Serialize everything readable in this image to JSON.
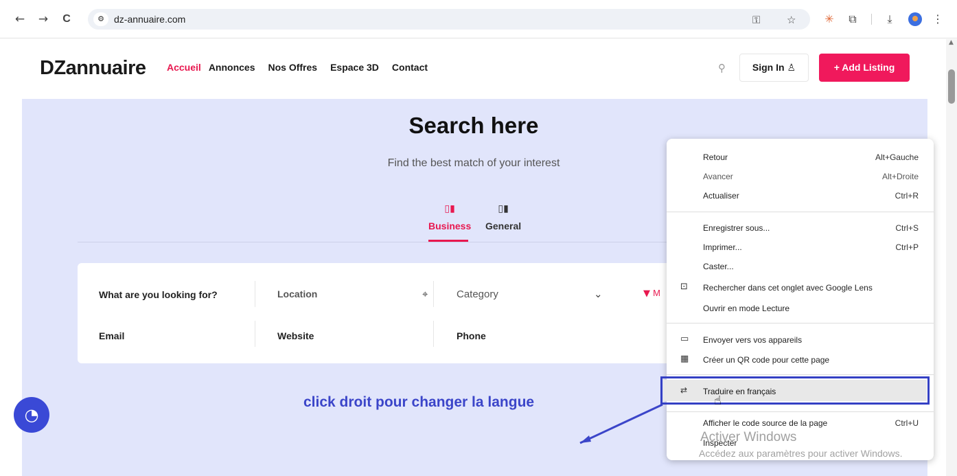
{
  "browser": {
    "url": "dz-annuaire.com",
    "site_info_icon": "tune-icon",
    "back_icon": "←",
    "forward_icon": "→",
    "reload_icon": "C"
  },
  "site": {
    "logo": "DZannuaire",
    "nav": [
      "Accueil",
      "Annonces",
      "Nos Offres",
      "Espace 3D",
      "Contact"
    ],
    "active_nav": "Accueil",
    "signin_label": "Sign In",
    "add_listing_label": "+ Add Listing",
    "accent_color": "#f0195c",
    "hero_bg": "#e1e5fb"
  },
  "hero": {
    "title": "Search here",
    "subtitle": "Find the best match of your interest",
    "tabs": [
      "Business",
      "General"
    ],
    "active_tab": "Business"
  },
  "search": {
    "what_label": "What are you looking for?",
    "location_placeholder": "Location",
    "category_placeholder": "Category",
    "filter_label": "M",
    "email_label": "Email",
    "website_label": "Website",
    "phone_label": "Phone"
  },
  "context_menu": {
    "items": [
      {
        "label": "Retour",
        "shortcut": "Alt+Gauche"
      },
      {
        "label": "Avancer",
        "shortcut": "Alt+Droite"
      },
      {
        "label": "Actualiser",
        "shortcut": "Ctrl+R"
      },
      {
        "label": "Enregistrer sous...",
        "shortcut": "Ctrl+S"
      },
      {
        "label": "Imprimer...",
        "shortcut": "Ctrl+P"
      },
      {
        "label": "Caster..."
      },
      {
        "label": "Rechercher dans cet onglet avec Google Lens",
        "icon": "lens-icon"
      },
      {
        "label": "Ouvrir en mode Lecture"
      },
      {
        "label": "Envoyer vers vos appareils",
        "icon": "devices-icon"
      },
      {
        "label": "Créer un QR code pour cette page",
        "icon": "qr-code-icon"
      },
      {
        "label": "Traduire en français",
        "icon": "translate-icon",
        "highlighted": true
      },
      {
        "label": "Afficher le code source de la page",
        "shortcut": "Ctrl+U"
      },
      {
        "label": "Inspecter"
      }
    ]
  },
  "annotation": "click droit pour changer la langue",
  "windows_watermark": {
    "line1": "Activer Windows",
    "line2": "Accédez aux paramètres pour activer Windows."
  }
}
